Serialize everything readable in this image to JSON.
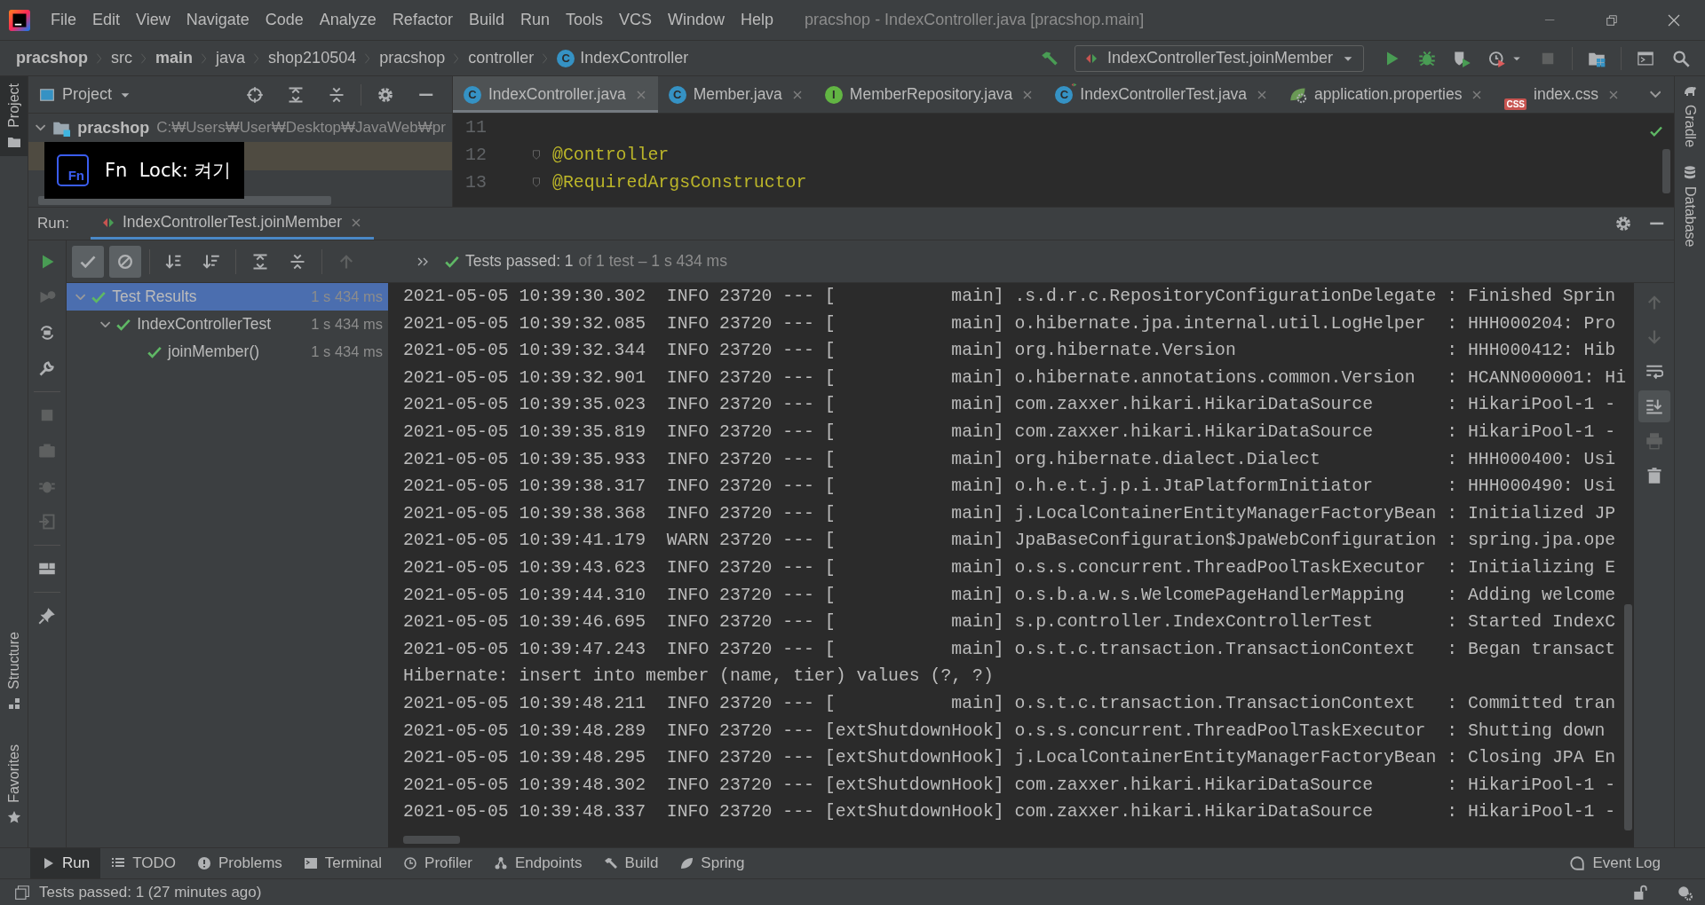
{
  "window": {
    "title": "pracshop - IndexController.java [pracshop.main]"
  },
  "menu": [
    "File",
    "Edit",
    "View",
    "Navigate",
    "Code",
    "Analyze",
    "Refactor",
    "Build",
    "Run",
    "Tools",
    "VCS",
    "Window",
    "Help"
  ],
  "breadcrumbs": [
    {
      "label": "pracshop",
      "kind": "folder",
      "bold": true
    },
    {
      "label": "src",
      "kind": "folder",
      "bold": false
    },
    {
      "label": "main",
      "kind": "folder",
      "bold": true
    },
    {
      "label": "java",
      "kind": "folder",
      "bold": false
    },
    {
      "label": "shop210504",
      "kind": "folder",
      "bold": false
    },
    {
      "label": "pracshop",
      "kind": "folder",
      "bold": false
    },
    {
      "label": "controller",
      "kind": "folder",
      "bold": false
    },
    {
      "label": "IndexController",
      "kind": "class",
      "icon_letter": "C",
      "bold": false
    }
  ],
  "run_configuration": {
    "label": "IndexControllerTest.joinMember"
  },
  "left_strip": [
    {
      "label": "Project",
      "kind": "project",
      "selected": true
    },
    {
      "label": "Structure",
      "kind": "structure",
      "selected": false
    },
    {
      "label": "Favorites",
      "kind": "favorites",
      "selected": false
    }
  ],
  "right_strip": [
    {
      "label": "Gradle",
      "kind": "gradle"
    },
    {
      "label": "Database",
      "kind": "database"
    }
  ],
  "project_panel": {
    "title": "Project",
    "tree": [
      {
        "name": "pracshop",
        "path": "C:₩Users₩User₩Desktop₩JavaWeb₩pr",
        "expanded": true
      }
    ]
  },
  "osd": {
    "icon_text": "Fn",
    "text": "Fn  Lock: 켜기"
  },
  "editor_tabs": [
    {
      "label": "IndexController.java",
      "kind": "class",
      "icon_letter": "C",
      "selected": true
    },
    {
      "label": "Member.java",
      "kind": "class",
      "icon_letter": "C",
      "selected": false
    },
    {
      "label": "MemberRepository.java",
      "kind": "interface",
      "icon_letter": "I",
      "selected": false
    },
    {
      "label": "IndexControllerTest.java",
      "kind": "test",
      "icon_letter": "C",
      "selected": false
    },
    {
      "label": "application.properties",
      "kind": "properties",
      "selected": false
    },
    {
      "label": "index.css",
      "kind": "css",
      "icon_letter": "CSS",
      "selected": false
    }
  ],
  "editor": {
    "lines": [
      {
        "number": "11"
      },
      {
        "number": "12",
        "code": "@Controller",
        "fold": true
      },
      {
        "number": "13",
        "code": "@RequiredArgsConstructor",
        "fold": true
      }
    ]
  },
  "run": {
    "label": "Run:",
    "tabs": [
      {
        "label": "IndexControllerTest.joinMember",
        "selected": true
      }
    ],
    "filters": [
      {
        "kind": "passed",
        "pressed": true
      },
      {
        "kind": "ignored",
        "pressed": true
      }
    ],
    "status": {
      "summary": "Tests passed: 1",
      "detail": "of 1 test – 1 s 434 ms"
    },
    "tests": [
      {
        "name": "Test Results",
        "time": "1 s 434 ms",
        "selected": true,
        "expanded": true,
        "children": [
          {
            "name": "IndexControllerTest",
            "time": "1 s 434 ms",
            "selected": false,
            "expanded": true,
            "children": [
              {
                "name": "joinMember()",
                "time": "1 s 434 ms",
                "selected": false
              }
            ]
          }
        ]
      }
    ],
    "console": [
      "2021-05-05 10:39:30.302  INFO 23720 --- [           main] .s.d.r.c.RepositoryConfigurationDelegate : Finished Sprin",
      "2021-05-05 10:39:32.085  INFO 23720 --- [           main] o.hibernate.jpa.internal.util.LogHelper  : HHH000204: Pro",
      "2021-05-05 10:39:32.344  INFO 23720 --- [           main] org.hibernate.Version                    : HHH000412: Hib",
      "2021-05-05 10:39:32.901  INFO 23720 --- [           main] o.hibernate.annotations.common.Version   : HCANN000001: Hi",
      "2021-05-05 10:39:35.023  INFO 23720 --- [           main] com.zaxxer.hikari.HikariDataSource       : HikariPool-1 -",
      "2021-05-05 10:39:35.819  INFO 23720 --- [           main] com.zaxxer.hikari.HikariDataSource       : HikariPool-1 -",
      "2021-05-05 10:39:35.933  INFO 23720 --- [           main] org.hibernate.dialect.Dialect            : HHH000400: Usi",
      "2021-05-05 10:39:38.317  INFO 23720 --- [           main] o.h.e.t.j.p.i.JtaPlatformInitiator       : HHH000490: Usi",
      "2021-05-05 10:39:38.368  INFO 23720 --- [           main] j.LocalContainerEntityManagerFactoryBean : Initialized JP",
      "2021-05-05 10:39:41.179  WARN 23720 --- [           main] JpaBaseConfiguration$JpaWebConfiguration : spring.jpa.ope",
      "2021-05-05 10:39:43.623  INFO 23720 --- [           main] o.s.s.concurrent.ThreadPoolTaskExecutor  : Initializing E",
      "2021-05-05 10:39:44.310  INFO 23720 --- [           main] o.s.b.a.w.s.WelcomePageHandlerMapping    : Adding welcome",
      "2021-05-05 10:39:46.695  INFO 23720 --- [           main] s.p.controller.IndexControllerTest       : Started IndexC",
      "2021-05-05 10:39:47.243  INFO 23720 --- [           main] o.s.t.c.transaction.TransactionContext   : Began transact",
      "Hibernate: insert into member (name, tier) values (?, ?)",
      "2021-05-05 10:39:48.211  INFO 23720 --- [           main] o.s.t.c.transaction.TransactionContext   : Committed tran",
      "2021-05-05 10:39:48.289  INFO 23720 --- [extShutdownHook] o.s.s.concurrent.ThreadPoolTaskExecutor  : Shutting down",
      "2021-05-05 10:39:48.295  INFO 23720 --- [extShutdownHook] j.LocalContainerEntityManagerFactoryBean : Closing JPA En",
      "2021-05-05 10:39:48.302  INFO 23720 --- [extShutdownHook] com.zaxxer.hikari.HikariDataSource       : HikariPool-1 -",
      "2021-05-05 10:39:48.337  INFO 23720 --- [extShutdownHook] com.zaxxer.hikari.HikariDataSource       : HikariPool-1 -"
    ]
  },
  "bottom_tabs": [
    {
      "label": "Run",
      "kind": "run",
      "selected": true
    },
    {
      "label": "TODO",
      "kind": "todo",
      "selected": false
    },
    {
      "label": "Problems",
      "kind": "problems",
      "selected": false
    },
    {
      "label": "Terminal",
      "kind": "terminal",
      "selected": false
    },
    {
      "label": "Profiler",
      "kind": "profiler",
      "selected": false
    },
    {
      "label": "Endpoints",
      "kind": "endpoints",
      "selected": false
    },
    {
      "label": "Build",
      "kind": "build",
      "selected": false
    },
    {
      "label": "Spring",
      "kind": "spring",
      "selected": false
    }
  ],
  "event_log": {
    "label": "Event Log"
  },
  "status_bar": {
    "text": "Tests passed: 1 (27 minutes ago)"
  }
}
